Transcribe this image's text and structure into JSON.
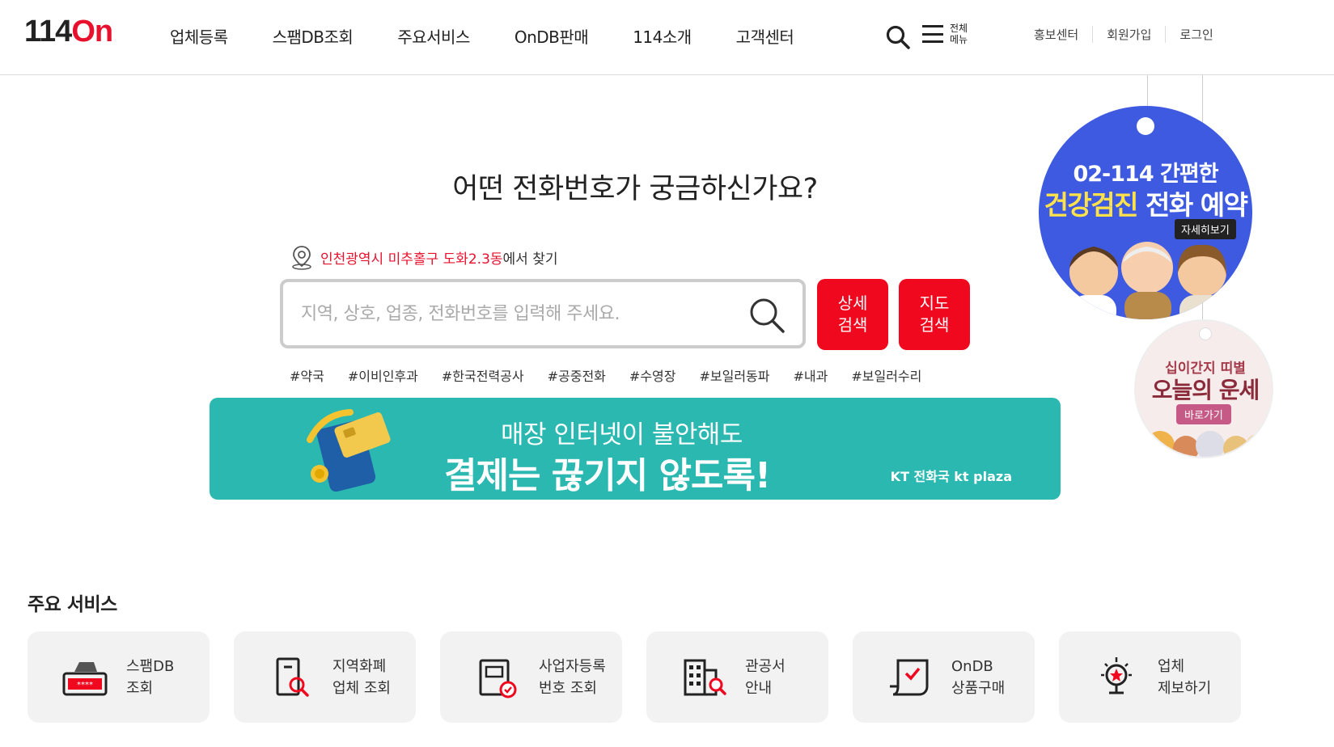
{
  "header": {
    "logo_num": "114",
    "logo_on": "On",
    "nav": [
      "업체등록",
      "스팸DB조회",
      "주요서비스",
      "OnDB판매",
      "114소개",
      "고객센터"
    ],
    "all_menu_line1": "전체",
    "all_menu_line2": "메뉴",
    "util": [
      "홍보센터",
      "회원가입",
      "로그인"
    ]
  },
  "hero": {
    "title": "어떤 전화번호가 궁금하신가요?",
    "location_region": "인천광역시 미추홀구 도화2.3동",
    "location_suffix": "에서 찾기",
    "search_placeholder": "지역, 상호, 업종, 전화번호를 입력해 주세요.",
    "search_value": "",
    "btn_detail_1": "상세",
    "btn_detail_2": "검색",
    "btn_map_1": "지도",
    "btn_map_2": "검색",
    "tags": [
      "#약국",
      "#이비인후과",
      "#한국전력공사",
      "#공중전화",
      "#수영장",
      "#보일러동파",
      "#내과",
      "#보일러수리"
    ]
  },
  "banner": {
    "line1": "매장 인터넷이 불안해도",
    "line2": "결제는 끊기지 않도록!",
    "brand": "KT 전화국 kt plaza"
  },
  "side": {
    "badge1_line1": "02-114 간편한",
    "badge1_line2a": "건강검진",
    "badge1_line2b": " 전화 예약",
    "badge1_more": "자세히보기",
    "badge2_line1": "십이간지 띠별",
    "badge2_line2": "오늘의 운세",
    "badge2_go": "바로가기"
  },
  "services": {
    "title": "주요 서비스",
    "items": [
      {
        "l1": "스팸DB",
        "l2": "조회",
        "icon": "spam-db-icon"
      },
      {
        "l1": "지역화폐",
        "l2": "업체 조회",
        "icon": "local-currency-icon"
      },
      {
        "l1": "사업자등록",
        "l2": "번호 조회",
        "icon": "business-reg-icon"
      },
      {
        "l1": "관공서",
        "l2": "안내",
        "icon": "public-office-icon"
      },
      {
        "l1": "OnDB",
        "l2": "상품구매",
        "icon": "ondb-purchase-icon"
      },
      {
        "l1": "업체",
        "l2": "제보하기",
        "icon": "report-business-icon"
      }
    ]
  },
  "colors": {
    "brand_red": "#e8112d",
    "button_red": "#f0081e",
    "banner_teal": "#2ab8b1",
    "badge_blue": "#3d5ae0"
  }
}
